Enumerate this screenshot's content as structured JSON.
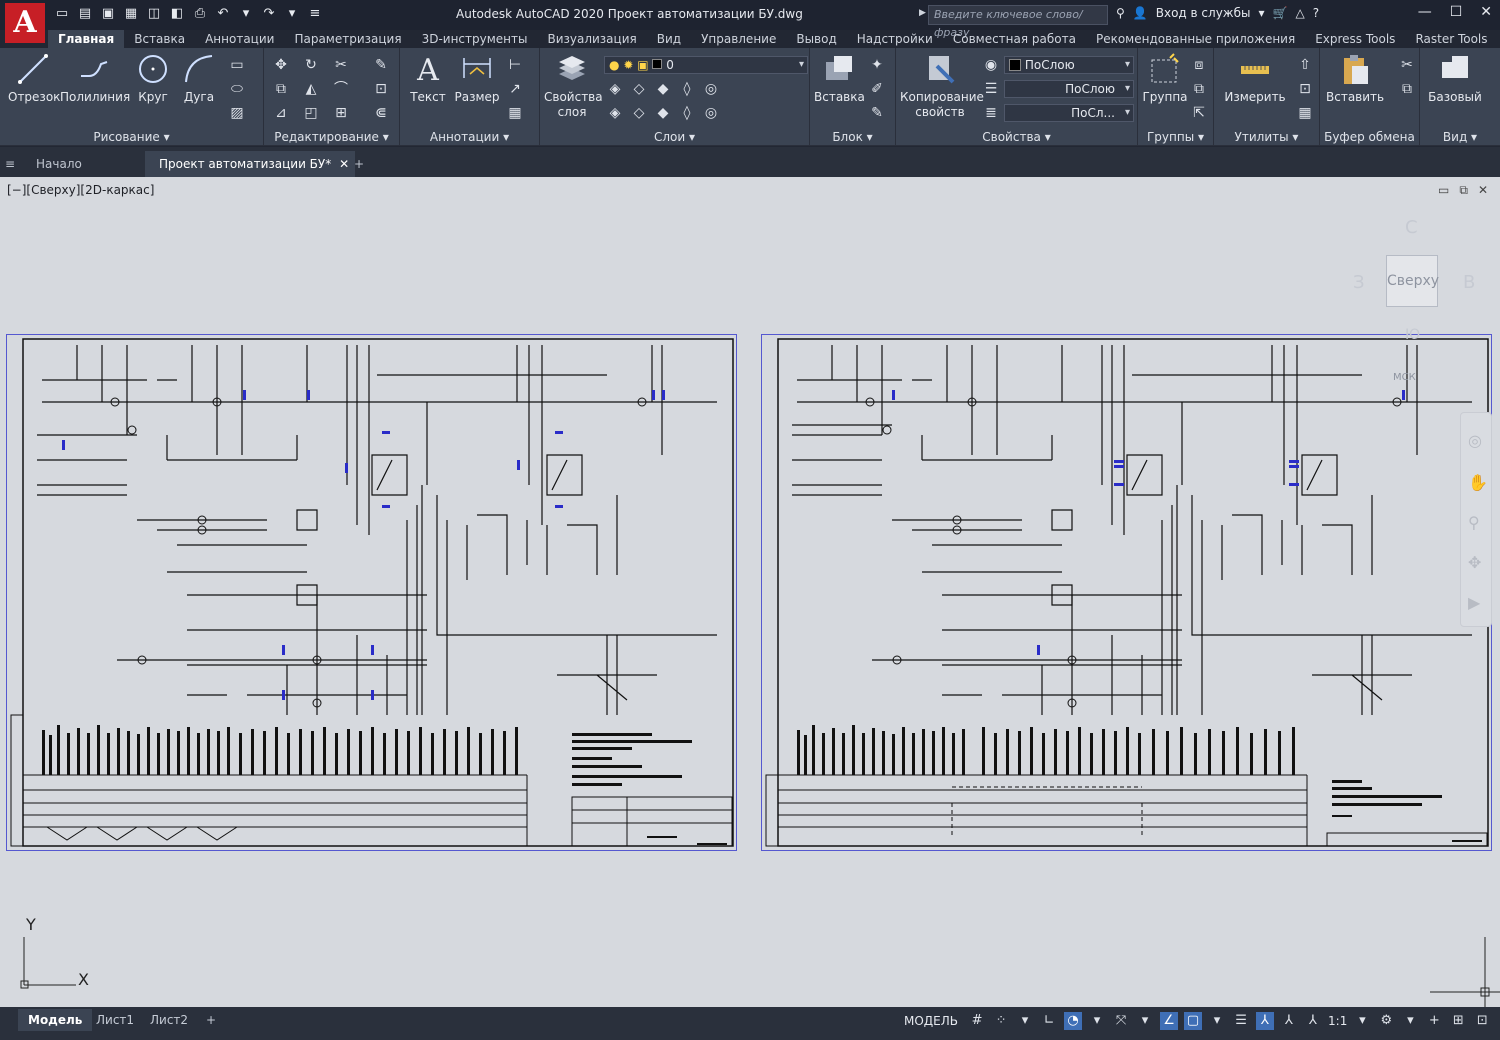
{
  "title_bar": {
    "app_title": "Autodesk AutoCAD 2020    Проект автоматизации БУ.dwg",
    "search_placeholder": "Введите ключевое слово/фразу",
    "sign_in": "Вход в службы",
    "help": "?"
  },
  "ribbon_tabs": [
    "Главная",
    "Вставка",
    "Аннотации",
    "Параметризация",
    "3D-инструменты",
    "Визуализация",
    "Вид",
    "Управление",
    "Вывод",
    "Надстройки",
    "Совместная работа",
    "Рекомендованные приложения",
    "Express Tools",
    "Raster Tools"
  ],
  "panels": {
    "draw": {
      "title": "Рисование",
      "line": "Отрезок",
      "polyline": "Полилиния",
      "circle": "Круг",
      "arc": "Дуга"
    },
    "modify": {
      "title": "Редактирование"
    },
    "annotation": {
      "title": "Аннотации",
      "text": "Текст",
      "dimension": "Размер"
    },
    "layers": {
      "title": "Слои",
      "properties_line1": "Свойства",
      "properties_line2": "слоя",
      "current_layer": "0"
    },
    "block": {
      "title": "Блок",
      "insert": "Вставка"
    },
    "properties": {
      "title": "Свойства",
      "match_line1": "Копирование",
      "match_line2": "свойств",
      "color": "ПоСлою",
      "linetype": "ПоСлою",
      "lineweight": "ПоСл..."
    },
    "groups": {
      "title": "Группы",
      "group": "Группа"
    },
    "utilities": {
      "title": "Утилиты",
      "measure": "Измерить"
    },
    "clipboard": {
      "title": "Буфер обмена",
      "paste": "Вставить"
    },
    "view": {
      "title": "Вид",
      "base": "Базовый"
    }
  },
  "doc_tabs": {
    "start": "Начало",
    "file": "Проект автоматизации БУ*"
  },
  "viewport": {
    "label": "[−][Сверху][2D-каркас]",
    "viewcube": {
      "face": "Сверху",
      "north": "С",
      "west": "З",
      "east": "В",
      "south": "Ю",
      "ucs": "МСК"
    },
    "ucs_x": "X",
    "ucs_y": "Y"
  },
  "layout_tabs": [
    "Модель",
    "Лист1",
    "Лист2"
  ],
  "status": {
    "mode": "МОДЕЛЬ",
    "scale": "1:1"
  },
  "colors": {
    "accent": "#3f6fb6",
    "sheet_border": "#5558d0",
    "canvas": "#d6d9de",
    "ribbon": "#3b4453"
  }
}
